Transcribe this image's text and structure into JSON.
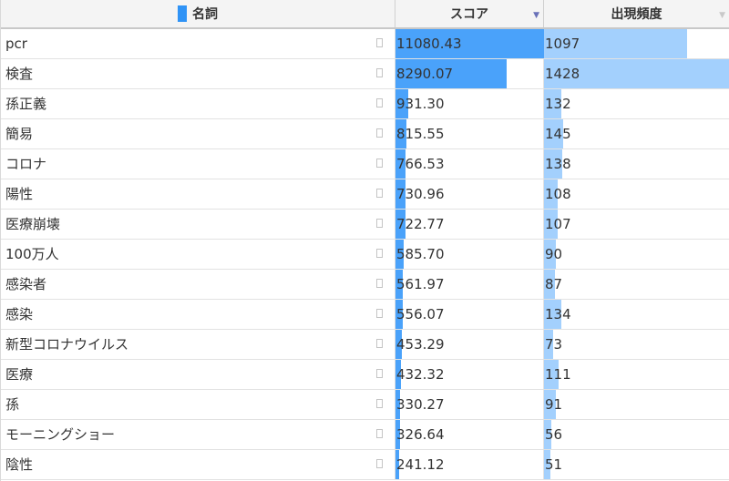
{
  "colors": {
    "score_bar": "#4aa2fa",
    "freq_bar": "#a3d0fd",
    "term_swatch": "#2f93f6",
    "sort_active": "#6870b8",
    "sort_inactive": "#c9c9c9"
  },
  "table": {
    "columns": [
      {
        "key": "term",
        "label": "名詞",
        "swatch": true,
        "sort": ""
      },
      {
        "key": "score",
        "label": "スコア",
        "swatch": false,
        "sort": "descending"
      },
      {
        "key": "freq",
        "label": "出現頻度",
        "swatch": false,
        "sort": "none"
      }
    ],
    "max_score": 11080.43,
    "max_freq": 1428,
    "rows": [
      {
        "term": "pcr",
        "score": "11080.43",
        "freq": "1097"
      },
      {
        "term": "検査",
        "score": "8290.07",
        "freq": "1428"
      },
      {
        "term": "孫正義",
        "score": "931.30",
        "freq": "132"
      },
      {
        "term": "簡易",
        "score": "815.55",
        "freq": "145"
      },
      {
        "term": "コロナ",
        "score": "766.53",
        "freq": "138"
      },
      {
        "term": "陽性",
        "score": "730.96",
        "freq": "108"
      },
      {
        "term": "医療崩壊",
        "score": "722.77",
        "freq": "107"
      },
      {
        "term": "100万人",
        "score": "585.70",
        "freq": "90"
      },
      {
        "term": "感染者",
        "score": "561.97",
        "freq": "87"
      },
      {
        "term": "感染",
        "score": "556.07",
        "freq": "134"
      },
      {
        "term": "新型コロナウイルス",
        "score": "453.29",
        "freq": "73"
      },
      {
        "term": "医療",
        "score": "432.32",
        "freq": "111"
      },
      {
        "term": "孫",
        "score": "330.27",
        "freq": "91"
      },
      {
        "term": "モーニングショー",
        "score": "326.64",
        "freq": "56"
      },
      {
        "term": "陰性",
        "score": "241.12",
        "freq": "51"
      }
    ]
  }
}
